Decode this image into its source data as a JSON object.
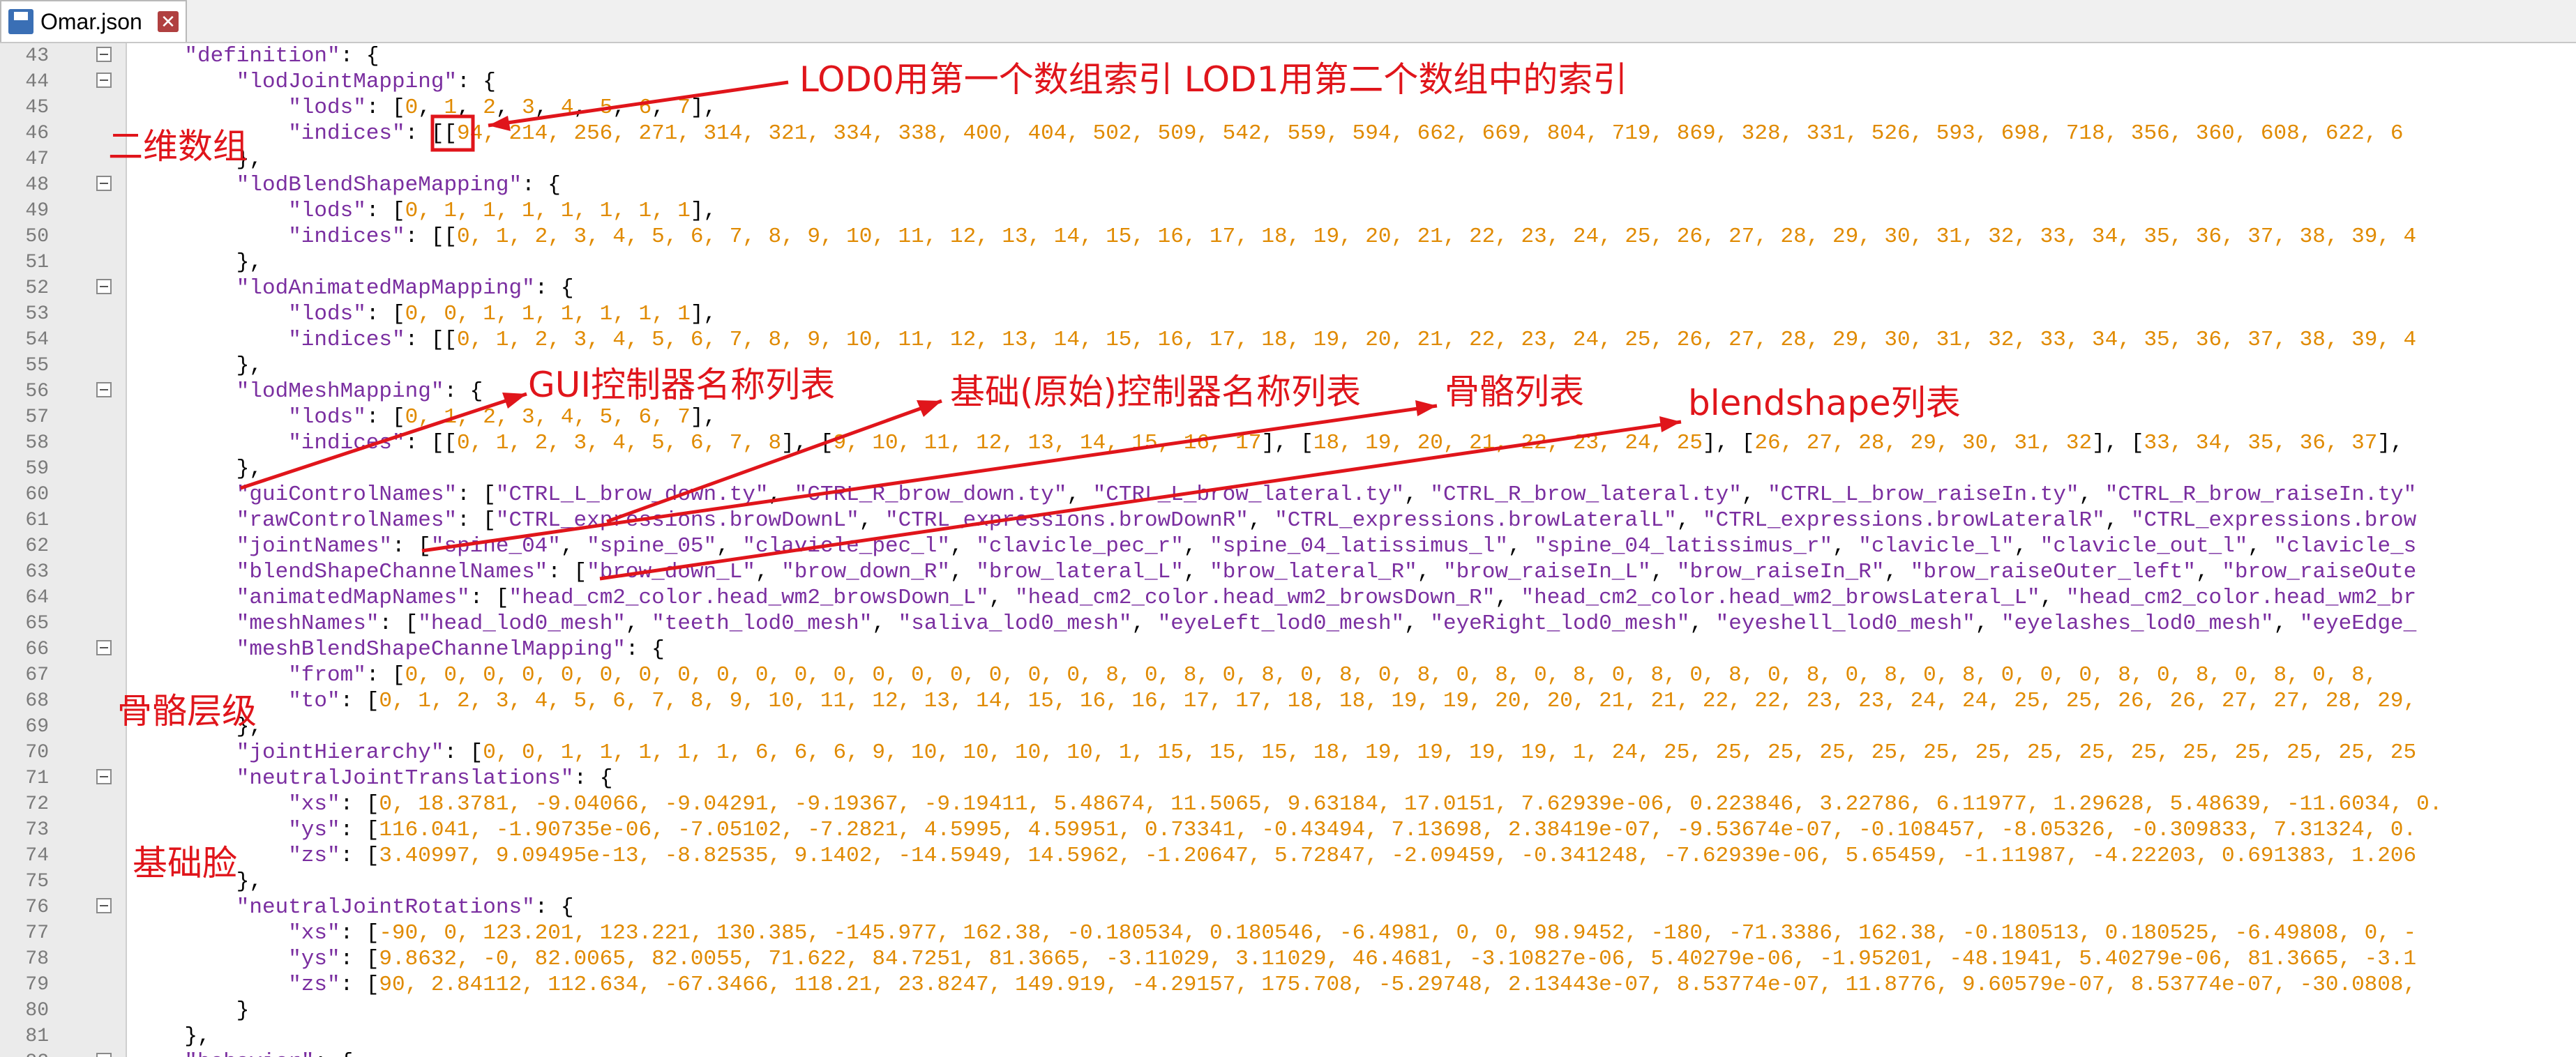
{
  "tab": {
    "title": "Omar.json",
    "icon": "floppy-disk-icon",
    "close_icon": "close-icon"
  },
  "lines": [
    {
      "n": "43",
      "indent": 4,
      "fold": true,
      "parts": [
        [
          "s",
          "\"definition\""
        ],
        [
          "p",
          ": {"
        ]
      ]
    },
    {
      "n": "44",
      "indent": 8,
      "fold": true,
      "parts": [
        [
          "s",
          "\"lodJointMapping\""
        ],
        [
          "p",
          ": {"
        ]
      ]
    },
    {
      "n": "45",
      "indent": 12,
      "fold": false,
      "parts": [
        [
          "s",
          "\"lods\""
        ],
        [
          "p",
          ": ["
        ],
        [
          "n",
          "0"
        ],
        [
          "p",
          ", "
        ],
        [
          "n",
          "1"
        ],
        [
          "p",
          ", "
        ],
        [
          "n",
          "2"
        ],
        [
          "p",
          ", "
        ],
        [
          "n",
          "3"
        ],
        [
          "p",
          ", "
        ],
        [
          "n",
          "4"
        ],
        [
          "p",
          ", "
        ],
        [
          "n",
          "5"
        ],
        [
          "p",
          ", "
        ],
        [
          "n",
          "6"
        ],
        [
          "p",
          ", "
        ],
        [
          "n",
          "7"
        ],
        [
          "p",
          "],"
        ]
      ]
    },
    {
      "n": "46",
      "indent": 12,
      "fold": false,
      "parts": [
        [
          "s",
          "\"indices\""
        ],
        [
          "p",
          ": [["
        ],
        [
          "n",
          "94, 214, 256, 271, 314, 321, 334, 338, 400, 404, 502, 509, 542, 559, 594, 662, 669, 804, 719, 869, 328, 331, 526, 593, 698, 718, 356, 360, 608, 622, 6"
        ]
      ]
    },
    {
      "n": "47",
      "indent": 8,
      "fold": false,
      "parts": [
        [
          "p",
          "},"
        ]
      ]
    },
    {
      "n": "48",
      "indent": 8,
      "fold": true,
      "parts": [
        [
          "s",
          "\"lodBlendShapeMapping\""
        ],
        [
          "p",
          ": {"
        ]
      ]
    },
    {
      "n": "49",
      "indent": 12,
      "fold": false,
      "parts": [
        [
          "s",
          "\"lods\""
        ],
        [
          "p",
          ": ["
        ],
        [
          "n",
          "0, 1, 1, 1, 1, 1, 1, 1"
        ],
        [
          "p",
          "],"
        ]
      ]
    },
    {
      "n": "50",
      "indent": 12,
      "fold": false,
      "parts": [
        [
          "s",
          "\"indices\""
        ],
        [
          "p",
          ": [["
        ],
        [
          "n",
          "0, 1, 2, 3, 4, 5, 6, 7, 8, 9, 10, 11, 12, 13, 14, 15, 16, 17, 18, 19, 20, 21, 22, 23, 24, 25, 26, 27, 28, 29, 30, 31, 32, 33, 34, 35, 36, 37, 38, 39, 4"
        ]
      ]
    },
    {
      "n": "51",
      "indent": 8,
      "fold": false,
      "parts": [
        [
          "p",
          "},"
        ]
      ]
    },
    {
      "n": "52",
      "indent": 8,
      "fold": true,
      "parts": [
        [
          "s",
          "\"lodAnimatedMapMapping\""
        ],
        [
          "p",
          ": {"
        ]
      ]
    },
    {
      "n": "53",
      "indent": 12,
      "fold": false,
      "parts": [
        [
          "s",
          "\"lods\""
        ],
        [
          "p",
          ": ["
        ],
        [
          "n",
          "0, 0, 1, 1, 1, 1, 1, 1"
        ],
        [
          "p",
          "],"
        ]
      ]
    },
    {
      "n": "54",
      "indent": 12,
      "fold": false,
      "parts": [
        [
          "s",
          "\"indices\""
        ],
        [
          "p",
          ": [["
        ],
        [
          "n",
          "0, 1, 2, 3, 4, 5, 6, 7, 8, 9, 10, 11, 12, 13, 14, 15, 16, 17, 18, 19, 20, 21, 22, 23, 24, 25, 26, 27, 28, 29, 30, 31, 32, 33, 34, 35, 36, 37, 38, 39, 4"
        ]
      ]
    },
    {
      "n": "55",
      "indent": 8,
      "fold": false,
      "parts": [
        [
          "p",
          "},"
        ]
      ]
    },
    {
      "n": "56",
      "indent": 8,
      "fold": true,
      "parts": [
        [
          "s",
          "\"lodMeshMapping\""
        ],
        [
          "p",
          ": {"
        ]
      ]
    },
    {
      "n": "57",
      "indent": 12,
      "fold": false,
      "parts": [
        [
          "s",
          "\"lods\""
        ],
        [
          "p",
          ": ["
        ],
        [
          "n",
          "0, 1, 2, 3, 4, 5, 6, 7"
        ],
        [
          "p",
          "],"
        ]
      ]
    },
    {
      "n": "58",
      "indent": 12,
      "fold": false,
      "parts": [
        [
          "s",
          "\"indices\""
        ],
        [
          "p",
          ": [["
        ],
        [
          "n",
          "0, 1, 2, 3, 4, 5, 6, 7, 8"
        ],
        [
          "p",
          "], ["
        ],
        [
          "n",
          "9, 10, 11, 12, 13, 14, 15, 16, 17"
        ],
        [
          "p",
          "], ["
        ],
        [
          "n",
          "18, 19, 20, 21, 22, 23, 24, 25"
        ],
        [
          "p",
          "], ["
        ],
        [
          "n",
          "26, 27, 28, 29, 30, 31, 32"
        ],
        [
          "p",
          "], ["
        ],
        [
          "n",
          "33, 34, 35, 36, 37"
        ],
        [
          "p",
          "],"
        ]
      ]
    },
    {
      "n": "59",
      "indent": 8,
      "fold": false,
      "parts": [
        [
          "p",
          "},"
        ]
      ]
    },
    {
      "n": "60",
      "indent": 8,
      "fold": false,
      "parts": [
        [
          "s",
          "\"guiControlNames\""
        ],
        [
          "p",
          ": ["
        ],
        [
          "s",
          "\"CTRL_L_brow_down.ty\""
        ],
        [
          "p",
          ", "
        ],
        [
          "s",
          "\"CTRL_R_brow_down.ty\""
        ],
        [
          "p",
          ", "
        ],
        [
          "s",
          "\"CTRL_L_brow_lateral.ty\""
        ],
        [
          "p",
          ", "
        ],
        [
          "s",
          "\"CTRL_R_brow_lateral.ty\""
        ],
        [
          "p",
          ", "
        ],
        [
          "s",
          "\"CTRL_L_brow_raiseIn.ty\""
        ],
        [
          "p",
          ", "
        ],
        [
          "s",
          "\"CTRL_R_brow_raiseIn.ty\""
        ]
      ]
    },
    {
      "n": "61",
      "indent": 8,
      "fold": false,
      "parts": [
        [
          "s",
          "\"rawControlNames\""
        ],
        [
          "p",
          ": ["
        ],
        [
          "s",
          "\"CTRL_expressions.browDownL\""
        ],
        [
          "p",
          ", "
        ],
        [
          "s",
          "\"CTRL_expressions.browDownR\""
        ],
        [
          "p",
          ", "
        ],
        [
          "s",
          "\"CTRL_expressions.browLateralL\""
        ],
        [
          "p",
          ", "
        ],
        [
          "s",
          "\"CTRL_expressions.browLateralR\""
        ],
        [
          "p",
          ", "
        ],
        [
          "s",
          "\"CTRL_expressions.brow"
        ]
      ]
    },
    {
      "n": "62",
      "indent": 8,
      "fold": false,
      "parts": [
        [
          "s",
          "\"jointNames\""
        ],
        [
          "p",
          ": ["
        ],
        [
          "s",
          "\"spine_04\""
        ],
        [
          "p",
          ", "
        ],
        [
          "s",
          "\"spine_05\""
        ],
        [
          "p",
          ", "
        ],
        [
          "s",
          "\"clavicle_pec_l\""
        ],
        [
          "p",
          ", "
        ],
        [
          "s",
          "\"clavicle_pec_r\""
        ],
        [
          "p",
          ", "
        ],
        [
          "s",
          "\"spine_04_latissimus_l\""
        ],
        [
          "p",
          ", "
        ],
        [
          "s",
          "\"spine_04_latissimus_r\""
        ],
        [
          "p",
          ", "
        ],
        [
          "s",
          "\"clavicle_l\""
        ],
        [
          "p",
          ", "
        ],
        [
          "s",
          "\"clavicle_out_l\""
        ],
        [
          "p",
          ", "
        ],
        [
          "s",
          "\"clavicle_s"
        ]
      ]
    },
    {
      "n": "63",
      "indent": 8,
      "fold": false,
      "parts": [
        [
          "s",
          "\"blendShapeChannelNames\""
        ],
        [
          "p",
          ": ["
        ],
        [
          "s",
          "\"brow_down_L\""
        ],
        [
          "p",
          ", "
        ],
        [
          "s",
          "\"brow_down_R\""
        ],
        [
          "p",
          ", "
        ],
        [
          "s",
          "\"brow_lateral_L\""
        ],
        [
          "p",
          ", "
        ],
        [
          "s",
          "\"brow_lateral_R\""
        ],
        [
          "p",
          ", "
        ],
        [
          "s",
          "\"brow_raiseIn_L\""
        ],
        [
          "p",
          ", "
        ],
        [
          "s",
          "\"brow_raiseIn_R\""
        ],
        [
          "p",
          ", "
        ],
        [
          "s",
          "\"brow_raiseOuter_left\""
        ],
        [
          "p",
          ", "
        ],
        [
          "s",
          "\"brow_raiseOute"
        ]
      ]
    },
    {
      "n": "64",
      "indent": 8,
      "fold": false,
      "parts": [
        [
          "s",
          "\"animatedMapNames\""
        ],
        [
          "p",
          ": ["
        ],
        [
          "s",
          "\"head_cm2_color.head_wm2_browsDown_L\""
        ],
        [
          "p",
          ", "
        ],
        [
          "s",
          "\"head_cm2_color.head_wm2_browsDown_R\""
        ],
        [
          "p",
          ", "
        ],
        [
          "s",
          "\"head_cm2_color.head_wm2_browsLateral_L\""
        ],
        [
          "p",
          ", "
        ],
        [
          "s",
          "\"head_cm2_color.head_wm2_br"
        ]
      ]
    },
    {
      "n": "65",
      "indent": 8,
      "fold": false,
      "parts": [
        [
          "s",
          "\"meshNames\""
        ],
        [
          "p",
          ": ["
        ],
        [
          "s",
          "\"head_lod0_mesh\""
        ],
        [
          "p",
          ", "
        ],
        [
          "s",
          "\"teeth_lod0_mesh\""
        ],
        [
          "p",
          ", "
        ],
        [
          "s",
          "\"saliva_lod0_mesh\""
        ],
        [
          "p",
          ", "
        ],
        [
          "s",
          "\"eyeLeft_lod0_mesh\""
        ],
        [
          "p",
          ", "
        ],
        [
          "s",
          "\"eyeRight_lod0_mesh\""
        ],
        [
          "p",
          ", "
        ],
        [
          "s",
          "\"eyeshell_lod0_mesh\""
        ],
        [
          "p",
          ", "
        ],
        [
          "s",
          "\"eyelashes_lod0_mesh\""
        ],
        [
          "p",
          ", "
        ],
        [
          "s",
          "\"eyeEdge_"
        ]
      ]
    },
    {
      "n": "66",
      "indent": 8,
      "fold": true,
      "parts": [
        [
          "s",
          "\"meshBlendShapeChannelMapping\""
        ],
        [
          "p",
          ": {"
        ]
      ]
    },
    {
      "n": "67",
      "indent": 12,
      "fold": false,
      "parts": [
        [
          "s",
          "\"from\""
        ],
        [
          "p",
          ": ["
        ],
        [
          "n",
          "0, 0, 0, 0, 0, 0, 0, 0, 0, 0, 0, 0, 0, 0, 0, 0, 0, 0, 8, 0, 8, 0, 8, 0, 8, 0, 8, 0, 8, 0, 8, 0, 8, 0, 8, 0, 8, 0, 8, 0, 8, 0, 0, 0, 8, 0, 8, 0, 8, 0, 8,"
        ]
      ]
    },
    {
      "n": "68",
      "indent": 12,
      "fold": false,
      "parts": [
        [
          "s",
          "\"to\""
        ],
        [
          "p",
          ": ["
        ],
        [
          "n",
          "0, 1, 2, 3, 4, 5, 6, 7, 8, 9, 10, 11, 12, 13, 14, 15, 16, 16, 17, 17, 18, 18, 19, 19, 20, 20, 21, 21, 22, 22, 23, 23, 24, 24, 25, 25, 26, 26, 27, 27, 28, 29,"
        ]
      ]
    },
    {
      "n": "69",
      "indent": 8,
      "fold": false,
      "parts": [
        [
          "p",
          "},"
        ]
      ]
    },
    {
      "n": "70",
      "indent": 8,
      "fold": false,
      "parts": [
        [
          "s",
          "\"jointHierarchy\""
        ],
        [
          "p",
          ": ["
        ],
        [
          "n",
          "0, 0, 1, 1, 1, 1, 1, 6, 6, 6, 9, 10, 10, 10, 10, 1, 15, 15, 15, 18, 19, 19, 19, 19, 1, 24, 25, 25, 25, 25, 25, 25, 25, 25, 25, 25, 25, 25, 25, 25, 25"
        ]
      ]
    },
    {
      "n": "71",
      "indent": 8,
      "fold": true,
      "parts": [
        [
          "s",
          "\"neutralJointTranslations\""
        ],
        [
          "p",
          ": {"
        ]
      ]
    },
    {
      "n": "72",
      "indent": 12,
      "fold": false,
      "parts": [
        [
          "s",
          "\"xs\""
        ],
        [
          "p",
          ": ["
        ],
        [
          "n",
          "0, 18.3781, -9.04066, -9.04291, -9.19367, -9.19411, 5.48674, 11.5065, 9.63184, 17.0151, 7.62939e-06, 0.223846, 3.22786, 6.11977, 1.29628, 5.48639, -11.6034, 0."
        ]
      ]
    },
    {
      "n": "73",
      "indent": 12,
      "fold": false,
      "parts": [
        [
          "s",
          "\"ys\""
        ],
        [
          "p",
          ": ["
        ],
        [
          "n",
          "116.041, -1.90735e-06, -7.05102, -7.2821, 4.5995, 4.59951, 0.73341, -0.43494, 7.13698, 2.38419e-07, -9.53674e-07, -0.108457, -8.05326, -0.309833, 7.31324, 0."
        ]
      ]
    },
    {
      "n": "74",
      "indent": 12,
      "fold": false,
      "parts": [
        [
          "s",
          "\"zs\""
        ],
        [
          "p",
          ": ["
        ],
        [
          "n",
          "3.40997, 9.09495e-13, -8.82535, 9.1402, -14.5949, 14.5962, -1.20647, 5.72847, -2.09459, -0.341248, -7.62939e-06, 5.65459, -1.11987, -4.22203, 0.691383, 1.206"
        ]
      ]
    },
    {
      "n": "75",
      "indent": 8,
      "fold": false,
      "parts": [
        [
          "p",
          "},"
        ]
      ]
    },
    {
      "n": "76",
      "indent": 8,
      "fold": true,
      "parts": [
        [
          "s",
          "\"neutralJointRotations\""
        ],
        [
          "p",
          ": {"
        ]
      ]
    },
    {
      "n": "77",
      "indent": 12,
      "fold": false,
      "parts": [
        [
          "s",
          "\"xs\""
        ],
        [
          "p",
          ": ["
        ],
        [
          "n",
          "-90, 0, 123.201, 123.221, 130.385, -145.977, 162.38, -0.180534, 0.180546, -6.4981, 0, 0, 98.9452, -180, -71.3386, 162.38, -0.180513, 0.180525, -6.49808, 0, -"
        ]
      ]
    },
    {
      "n": "78",
      "indent": 12,
      "fold": false,
      "parts": [
        [
          "s",
          "\"ys\""
        ],
        [
          "p",
          ": ["
        ],
        [
          "n",
          "9.8632, -0, 82.0065, 82.0055, 71.622, 84.7251, 81.3665, -3.11029, 3.11029, 46.4681, -3.10827e-06, 5.40279e-06, -1.95201, -48.1941, 5.40279e-06, 81.3665, -3.1"
        ]
      ]
    },
    {
      "n": "79",
      "indent": 12,
      "fold": false,
      "parts": [
        [
          "s",
          "\"zs\""
        ],
        [
          "p",
          ": ["
        ],
        [
          "n",
          "90, 2.84112, 112.634, -67.3466, 118.21, 23.8247, 149.919, -4.29157, 175.708, -5.29748, 2.13443e-07, 8.53774e-07, 11.8776, 9.60579e-07, 8.53774e-07, -30.0808,"
        ]
      ]
    },
    {
      "n": "80",
      "indent": 8,
      "fold": false,
      "parts": [
        [
          "p",
          "}"
        ]
      ]
    },
    {
      "n": "81",
      "indent": 4,
      "fold": false,
      "parts": [
        [
          "p",
          "},"
        ]
      ]
    },
    {
      "n": "82",
      "indent": 4,
      "fold": true,
      "parts": [
        [
          "s",
          "\"behavior\""
        ],
        [
          "p",
          ": {"
        ]
      ]
    }
  ],
  "annotations": {
    "lod_index": "LOD0用第一个数组索引 LOD1用第二个数组中的索引",
    "two_dim": "二维数组",
    "gui_names": "GUI控制器名称列表",
    "raw_names": "基础(原始)控制器名称列表",
    "joint_list": "骨骼列表",
    "blendshape_list": "blendshape列表",
    "hierarchy": "骨骼层级",
    "neutral_face": "基础脸"
  },
  "colors": {
    "annotation": "#e0151b",
    "keyword": "#7a2ea0",
    "number": "#e08a00"
  }
}
